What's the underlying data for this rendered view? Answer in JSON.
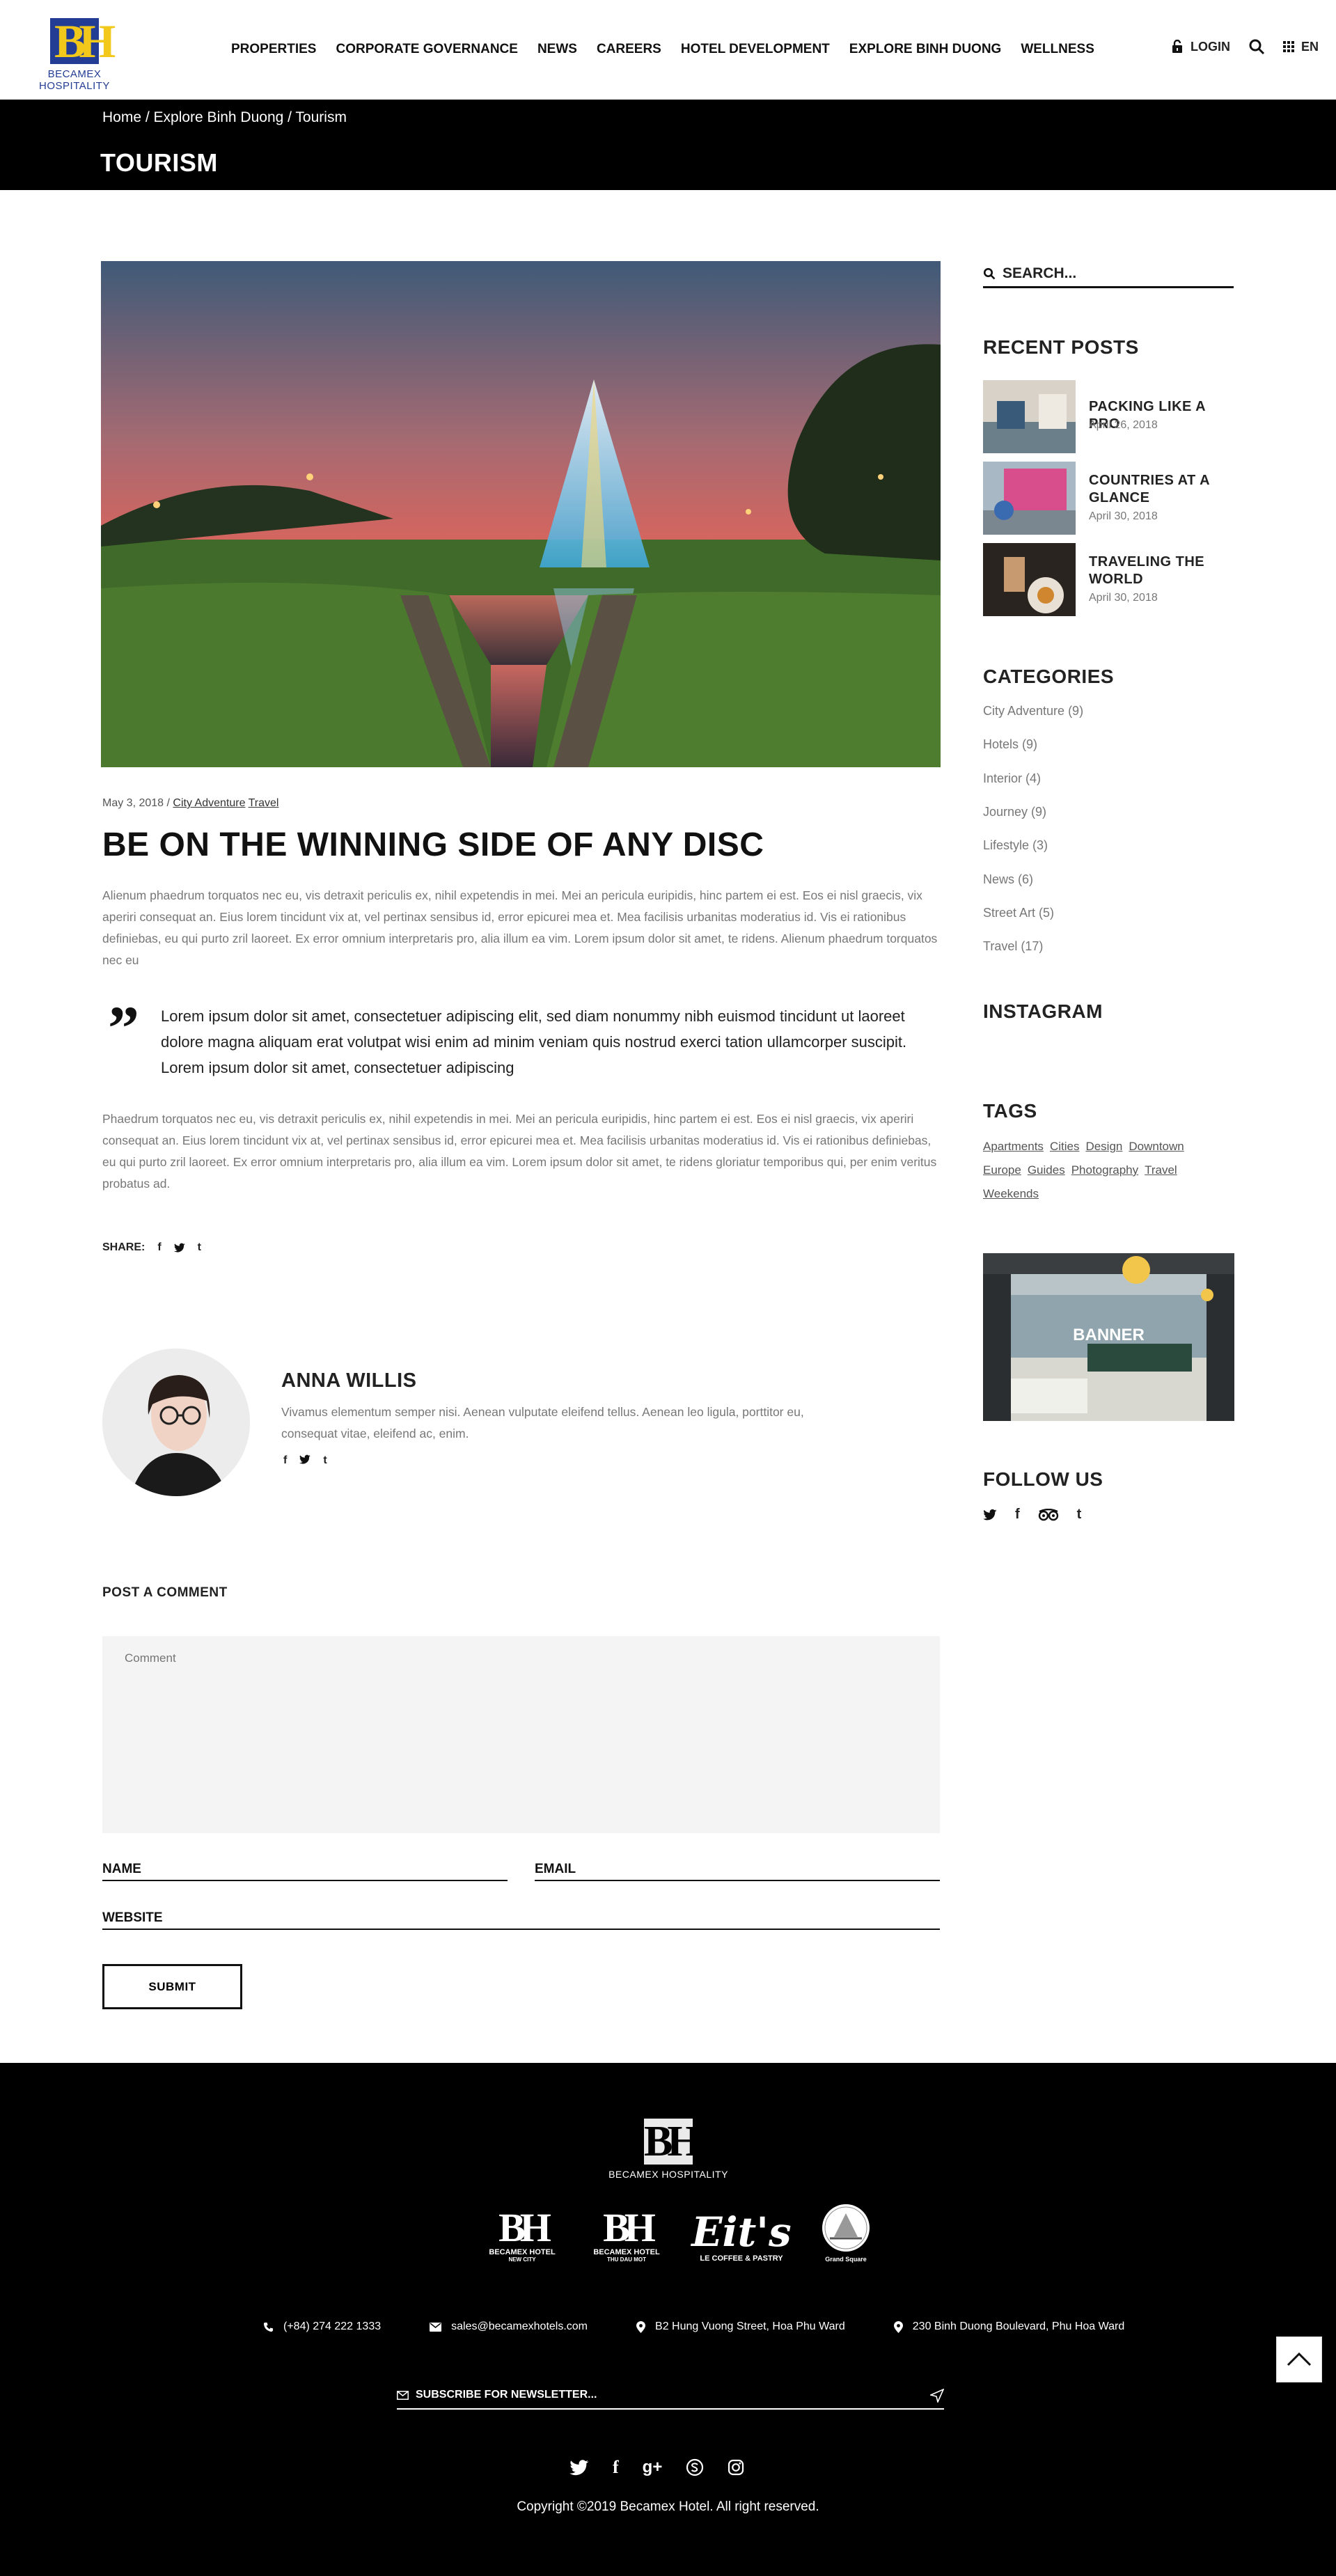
{
  "header": {
    "logo_text": "BECAMEX HOSPITALITY",
    "nav": [
      "PROPERTIES",
      "CORPORATE GOVERNANCE",
      "NEWS",
      "CAREERS",
      "HOTEL DEVELOPMENT",
      "EXPLORE BINH DUONG",
      "WELLNESS"
    ],
    "login": "LOGIN",
    "lang": "EN"
  },
  "breadcrumb": "Home / Explore Binh Duong / Tourism",
  "page_title": "TOURISM",
  "article": {
    "date": "May 3, 2018 /",
    "categories": [
      "City Adventure",
      "Travel"
    ],
    "title": "BE ON THE WINNING SIDE OF ANY DISC",
    "para1": "Alienum phaedrum torquatos nec eu, vis detraxit periculis ex, nihil expetendis in mei. Mei an pericula euripidis, hinc partem ei est. Eos ei nisl graecis, vix aperiri consequat an. Eius lorem tincidunt vix at, vel pertinax sensibus id, error epicurei mea et. Mea facilisis urbanitas moderatius id. Vis ei rationibus definiebas, eu qui purto zril laoreet. Ex error omnium interpretaris pro, alia illum ea vim. Lorem ipsum dolor sit amet, te ridens. Alienum phaedrum torquatos nec eu",
    "quote": "Lorem ipsum dolor sit amet, consectetuer adipiscing elit, sed diam nonummy nibh euismod tincidunt ut laoreet dolore magna aliquam erat volutpat wisi enim ad minim veniam quis nostrud exerci tation ullamcorper suscipit. Lorem ipsum dolor sit amet, consectetuer adipiscing",
    "para2": "Phaedrum torquatos nec eu, vis detraxit periculis ex, nihil expetendis in mei. Mei an pericula euripidis, hinc partem ei est. Eos ei nisl graecis, vix aperiri consequat an. Eius lorem tincidunt vix at, vel pertinax sensibus id, error epicurei mea et. Mea facilisis urbanitas moderatius id. Vis ei rationibus definiebas, eu qui purto zril laoreet. Ex error omnium interpretaris pro, alia illum ea vim. Lorem ipsum dolor sit amet, te ridens gloriatur temporibus qui, per enim veritus probatus ad.",
    "share_label": "SHARE:"
  },
  "author": {
    "name": "ANNA WILLIS",
    "bio": "Vivamus elementum semper nisi. Aenean vulputate eleifend tellus. Aenean leo ligula, porttitor eu, consequat vitae, eleifend ac, enim."
  },
  "comment_form": {
    "heading": "POST A COMMENT",
    "comment_placeholder": "Comment",
    "name_label": "NAME",
    "email_label": "EMAIL",
    "website_label": "WEBSITE",
    "submit": "SUBMIT"
  },
  "sidebar": {
    "search_placeholder": "SEARCH...",
    "recent_heading": "RECENT POSTS",
    "recent_posts": [
      {
        "title": "PACKING LIKE A PRO",
        "date": "April 26, 2018"
      },
      {
        "title": "COUNTRIES AT A GLANCE",
        "date": "April 30, 2018"
      },
      {
        "title": "TRAVELING THE WORLD",
        "date": "April 30, 2018"
      }
    ],
    "categories_heading": "CATEGORIES",
    "categories": [
      "City Adventure (9)",
      "Hotels (9)",
      "Interior (4)",
      "Journey (9)",
      "Lifestyle (3)",
      "News (6)",
      "Street Art (5)",
      "Travel (17)"
    ],
    "instagram_heading": "INSTAGRAM",
    "tags_heading": "TAGS",
    "tags": [
      "Apartments",
      "Cities",
      "Design",
      "Downtown",
      "Europe",
      "Guides",
      "Photography",
      "Travel",
      "Weekends"
    ],
    "banner_text": "BANNER",
    "follow_heading": "FOLLOW US"
  },
  "footer": {
    "logo_text": "BECAMEX HOSPITALITY",
    "brands": [
      {
        "name": "BECAMEX HOTEL",
        "sub": "NEW CITY"
      },
      {
        "name": "BECAMEX HOTEL",
        "sub": "THU DAU MOT"
      },
      {
        "name": "LE COFFEE & PASTRY",
        "sub": "Eit's"
      },
      {
        "name": "Grand Square",
        "sub": ""
      }
    ],
    "phone": "(+84) 274 222 1333",
    "email": "sales@becamexhotels.com",
    "address1": "B2 Hung Vuong Street, Hoa Phu Ward",
    "address2": "230 Binh Duong Boulevard, Phu Hoa Ward",
    "newsletter_placeholder": "SUBSCRIBE FOR NEWSLETTER...",
    "copyright": "Copyright ©2019 Becamex Hotel. All right reserved."
  }
}
